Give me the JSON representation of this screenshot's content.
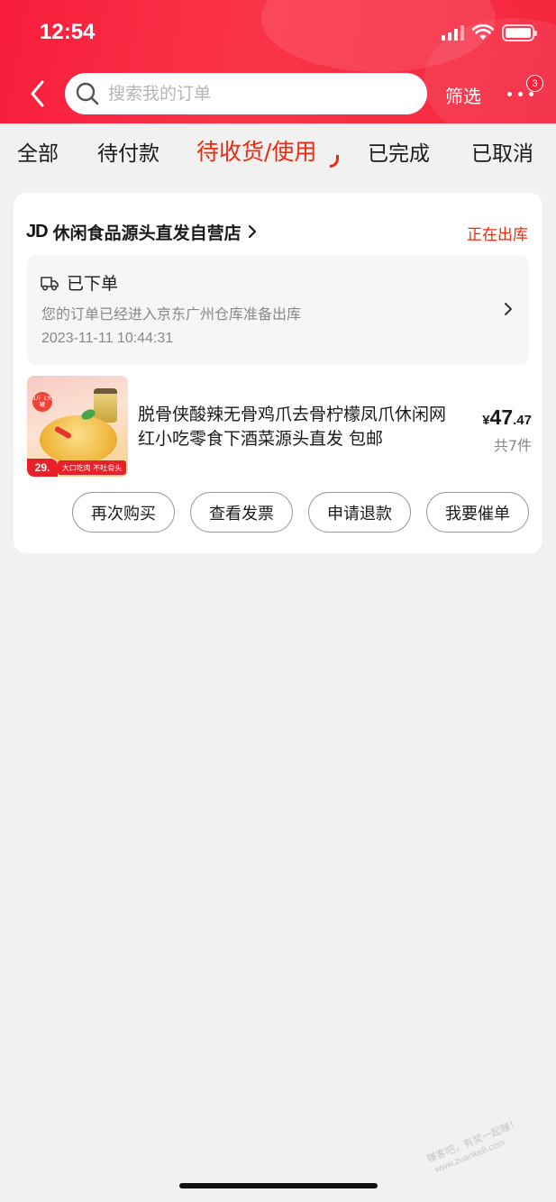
{
  "status_bar": {
    "time": "12:54"
  },
  "nav": {
    "search_placeholder": "搜索我的订单",
    "filter_label": "筛选",
    "more_badge": "3"
  },
  "tabs": [
    {
      "label": "全部",
      "active": false
    },
    {
      "label": "待付款",
      "active": false
    },
    {
      "label": "待收货/使用",
      "active": true
    },
    {
      "label": "已完成",
      "active": false
    },
    {
      "label": "已取消",
      "active": false
    }
  ],
  "order": {
    "shop_logo": "JD",
    "shop_name": "休闲食品源头直发自营店",
    "status": "正在出库",
    "logistics": {
      "title": "已下单",
      "description": "您的订单已经进入京东广州仓库准备出库",
      "time": "2023-11-11 10:44:31"
    },
    "product": {
      "title": "脱骨侠酸辣无骨鸡爪去骨柠檬凤爪休闲网红小吃零食下酒菜源头直发 包邮",
      "price_currency": "¥",
      "price_integer": "47",
      "price_decimal": ".47",
      "quantity": "共7件",
      "thumb_price": "29.",
      "thumb_slogan": "大口吃肉 不吐骨头",
      "thumb_weight": "1斤 1大罐"
    },
    "actions": {
      "rebuy": "再次购买",
      "invoice": "查看发票",
      "refund": "申请退款",
      "urge": "我要催单"
    }
  },
  "watermark": {
    "line1": "赚客吧，有奖一起赚！",
    "line2": "www.zuanke8.com"
  },
  "colors": {
    "brand_red": "#f2270c",
    "header_red": "#f81d3c",
    "page_bg": "#f1f1f1"
  }
}
